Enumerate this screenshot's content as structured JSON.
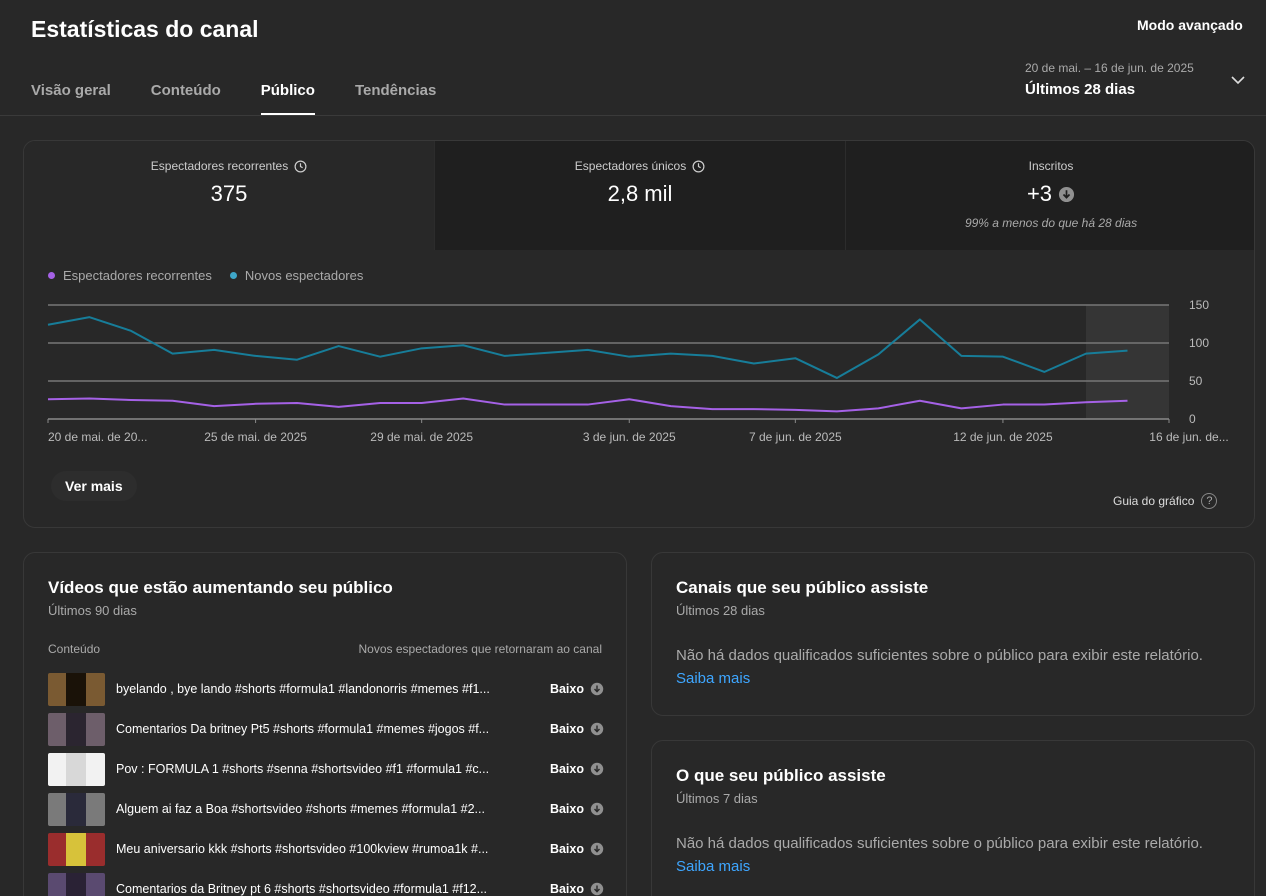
{
  "header": {
    "title": "Estatísticas do canal",
    "advanced_label": "Modo avançado",
    "tabs": [
      {
        "label": "Visão geral",
        "active": false
      },
      {
        "label": "Conteúdo",
        "active": false
      },
      {
        "label": "Público",
        "active": true
      },
      {
        "label": "Tendências",
        "active": false
      }
    ],
    "date_range": {
      "dates": "20 de mai. – 16 de jun. de 2025",
      "label": "Últimos 28 dias"
    }
  },
  "metrics": [
    {
      "label": "Espectadores recorrentes",
      "value": "375",
      "icon": "clock-icon"
    },
    {
      "label": "Espectadores únicos",
      "value": "2,8 mil",
      "icon": "clock-icon"
    },
    {
      "label": "Inscritos",
      "value": "+3",
      "icon": "arrow-down-circle-icon",
      "note": "99% a menos do que há 28 dias"
    }
  ],
  "chart_data": {
    "type": "line",
    "legend": [
      {
        "name": "Espectadores recorrentes",
        "color": "#a561e6"
      },
      {
        "name": "Novos espectadores",
        "color": "#3ea6c8"
      }
    ],
    "x": [
      "2025-05-20",
      "2025-05-21",
      "2025-05-22",
      "2025-05-23",
      "2025-05-24",
      "2025-05-25",
      "2025-05-26",
      "2025-05-27",
      "2025-05-28",
      "2025-05-29",
      "2025-05-30",
      "2025-05-31",
      "2025-06-01",
      "2025-06-02",
      "2025-06-03",
      "2025-06-04",
      "2025-06-05",
      "2025-06-06",
      "2025-06-07",
      "2025-06-08",
      "2025-06-09",
      "2025-06-10",
      "2025-06-11",
      "2025-06-12",
      "2025-06-13",
      "2025-06-14",
      "2025-06-15"
    ],
    "series": [
      {
        "name": "Novos espectadores",
        "color": "#177d99",
        "values": [
          124,
          134,
          116,
          86,
          91,
          83,
          78,
          96,
          82,
          93,
          97,
          83,
          87,
          91,
          82,
          86,
          83,
          73,
          80,
          54,
          85,
          131,
          83,
          82,
          62,
          86,
          90
        ]
      },
      {
        "name": "Espectadores recorrentes",
        "color": "#a561e6",
        "values": [
          26,
          27,
          25,
          24,
          17,
          20,
          21,
          16,
          21,
          21,
          27,
          19,
          19,
          19,
          26,
          17,
          13,
          13,
          12,
          10,
          14,
          24,
          14,
          19,
          19,
          22,
          24
        ]
      }
    ],
    "ylim": [
      0,
      150
    ],
    "yticks": [
      0,
      50,
      100,
      150
    ],
    "xtick_labels": [
      {
        "label": "20 de mai. de 20...",
        "index": 0
      },
      {
        "label": "25 de mai. de 2025",
        "index": 5
      },
      {
        "label": "29 de mai. de 2025",
        "index": 9
      },
      {
        "label": "3 de jun. de 2025",
        "index": 14
      },
      {
        "label": "7 de jun. de 2025",
        "index": 18
      },
      {
        "label": "12 de jun. de 2025",
        "index": 23
      },
      {
        "label": "16 de jun. de...",
        "index": 27
      }
    ],
    "shaded_from_index": 25
  },
  "chart_actions": {
    "more_label": "Ver mais",
    "guide_label": "Guia do gráfico",
    "guide_icon": "question-icon"
  },
  "videos_card": {
    "title": "Vídeos que estão aumentando seu público",
    "subtitle": "Últimos 90 dias",
    "col_content": "Conteúdo",
    "col_metric": "Novos espectadores que retornaram ao canal",
    "rows": [
      {
        "title": "byelando , bye lando #shorts #formula1 #landonorris #memes #f1...",
        "level": "Baixo",
        "thumb_bg": "#7a5a32",
        "thumb_fg": "#1a1208"
      },
      {
        "title": "Comentarios Da britney Pt5 #shorts #formula1 #memes #jogos #f...",
        "level": "Baixo",
        "thumb_bg": "#6d5e6a",
        "thumb_fg": "#2b2530"
      },
      {
        "title": "Pov : FORMULA 1 #shorts #senna #shortsvideo #f1 #formula1 #c...",
        "level": "Baixo",
        "thumb_bg": "#f2f2f2",
        "thumb_fg": "#d8d8d8"
      },
      {
        "title": "Alguem ai faz a Boa #shortsvideo #shorts #memes #formula1 #2...",
        "level": "Baixo",
        "thumb_bg": "#7a7a7a",
        "thumb_fg": "#2a2a3a"
      },
      {
        "title": "Meu aniversario kkk #shorts #shortsvideo #100kview #rumoa1k #...",
        "level": "Baixo",
        "thumb_bg": "#9a2d2d",
        "thumb_fg": "#d7c23a"
      },
      {
        "title": "Comentarios da Britney pt 6 #shorts #shortsvideo #formula1 #f12...",
        "level": "Baixo",
        "thumb_bg": "#5a4a70",
        "thumb_fg": "#2a2235"
      }
    ]
  },
  "canais_card": {
    "title": "Canais que seu público assiste",
    "subtitle": "Últimos 28 dias",
    "message": "Não há dados qualificados suficientes sobre o público para exibir este relatório.",
    "link": "Saiba mais"
  },
  "oque_card": {
    "title": "O que seu público assiste",
    "subtitle": "Últimos 7 dias",
    "message": "Não há dados qualificados suficientes sobre o público para exibir este relatório.",
    "link": "Saiba mais"
  }
}
